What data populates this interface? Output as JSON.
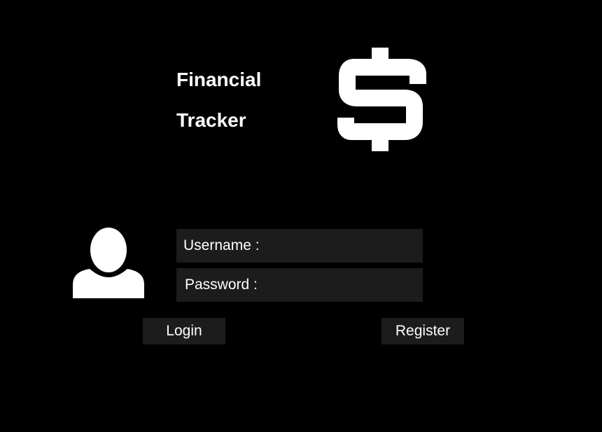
{
  "header": {
    "title_line_1": "Financial",
    "title_line_2": "Tracker",
    "logo_icon": "dollar-sign-icon"
  },
  "login_form": {
    "avatar_icon": "user-silhouette-icon",
    "username_label": "Username :",
    "password_label": "Password :",
    "login_label": "Login",
    "register_label": "Register"
  },
  "colors": {
    "background": "#000000",
    "field_background": "#1c1c1c",
    "text": "#ffffff"
  }
}
